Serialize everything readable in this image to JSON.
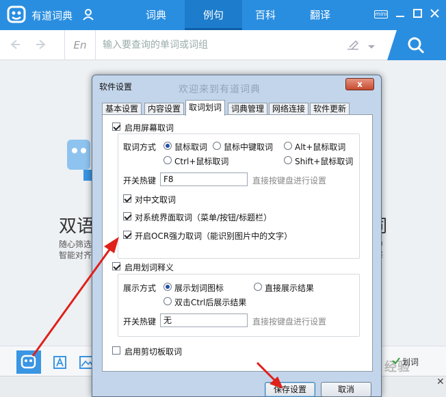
{
  "app": {
    "title": "有道词典",
    "nav_tabs": [
      {
        "label": "词典",
        "active": false
      },
      {
        "label": "例句",
        "active": true
      },
      {
        "label": "百科",
        "active": false
      },
      {
        "label": "翻译",
        "active": false
      }
    ],
    "mini_label": "mini",
    "accent": "#2a8ee0"
  },
  "search": {
    "lang": "En",
    "placeholder": "输入要查询的单词或词组"
  },
  "background": {
    "heading_left": "双语",
    "heading_right": "词",
    "line1": "随心筛选",
    "line2": "智能对齐",
    "line1_right": "中",
    "line2_right": "释",
    "huaci_label": "划词",
    "watermark": "Baidu 经验"
  },
  "dialog": {
    "title": "软件设置",
    "ghost_title": "欢迎来到有道词典",
    "close_label": "x",
    "tabs": [
      {
        "label": "基本设置",
        "active": false
      },
      {
        "label": "内容设置",
        "active": false
      },
      {
        "label": "取词划词",
        "active": true
      },
      {
        "label": "词典管理",
        "active": false
      },
      {
        "label": "网络连接",
        "active": false
      },
      {
        "label": "软件更新",
        "active": false
      }
    ],
    "screen_capture": {
      "label": "启用屏幕取词",
      "checked": true,
      "method_label": "取词方式",
      "methods": [
        {
          "label": "鼠标取词",
          "selected": true
        },
        {
          "label": "鼠标中键取词",
          "selected": false
        },
        {
          "label": "Alt+鼠标取词",
          "selected": false
        },
        {
          "label": "Ctrl+鼠标取词",
          "selected": false
        },
        {
          "label": "Shift+鼠标取词",
          "selected": false
        }
      ],
      "hotkey_label": "开关热键",
      "hotkey_value": "F8",
      "hotkey_hint": "直接按键盘进行设置",
      "options": [
        {
          "label": "对中文取词",
          "checked": true
        },
        {
          "label": "对系统界面取词（菜单/按钮/标题栏）",
          "checked": true
        },
        {
          "label": "开启OCR强力取词（能识别图片中的文字）",
          "checked": true
        }
      ]
    },
    "selection": {
      "label": "启用划词释义",
      "checked": true,
      "display_label": "展示方式",
      "modes": [
        {
          "label": "展示划词图标",
          "selected": true
        },
        {
          "label": "直接展示结果",
          "selected": false
        },
        {
          "label": "双击Ctrl后展示结果",
          "selected": false
        }
      ],
      "hotkey_label": "开关热键",
      "hotkey_value": "无",
      "hotkey_hint": "直接按键盘进行设置"
    },
    "clipboard": {
      "label": "启用剪切板取词",
      "checked": false
    },
    "save_label": "保存设置",
    "cancel_label": "取消"
  }
}
